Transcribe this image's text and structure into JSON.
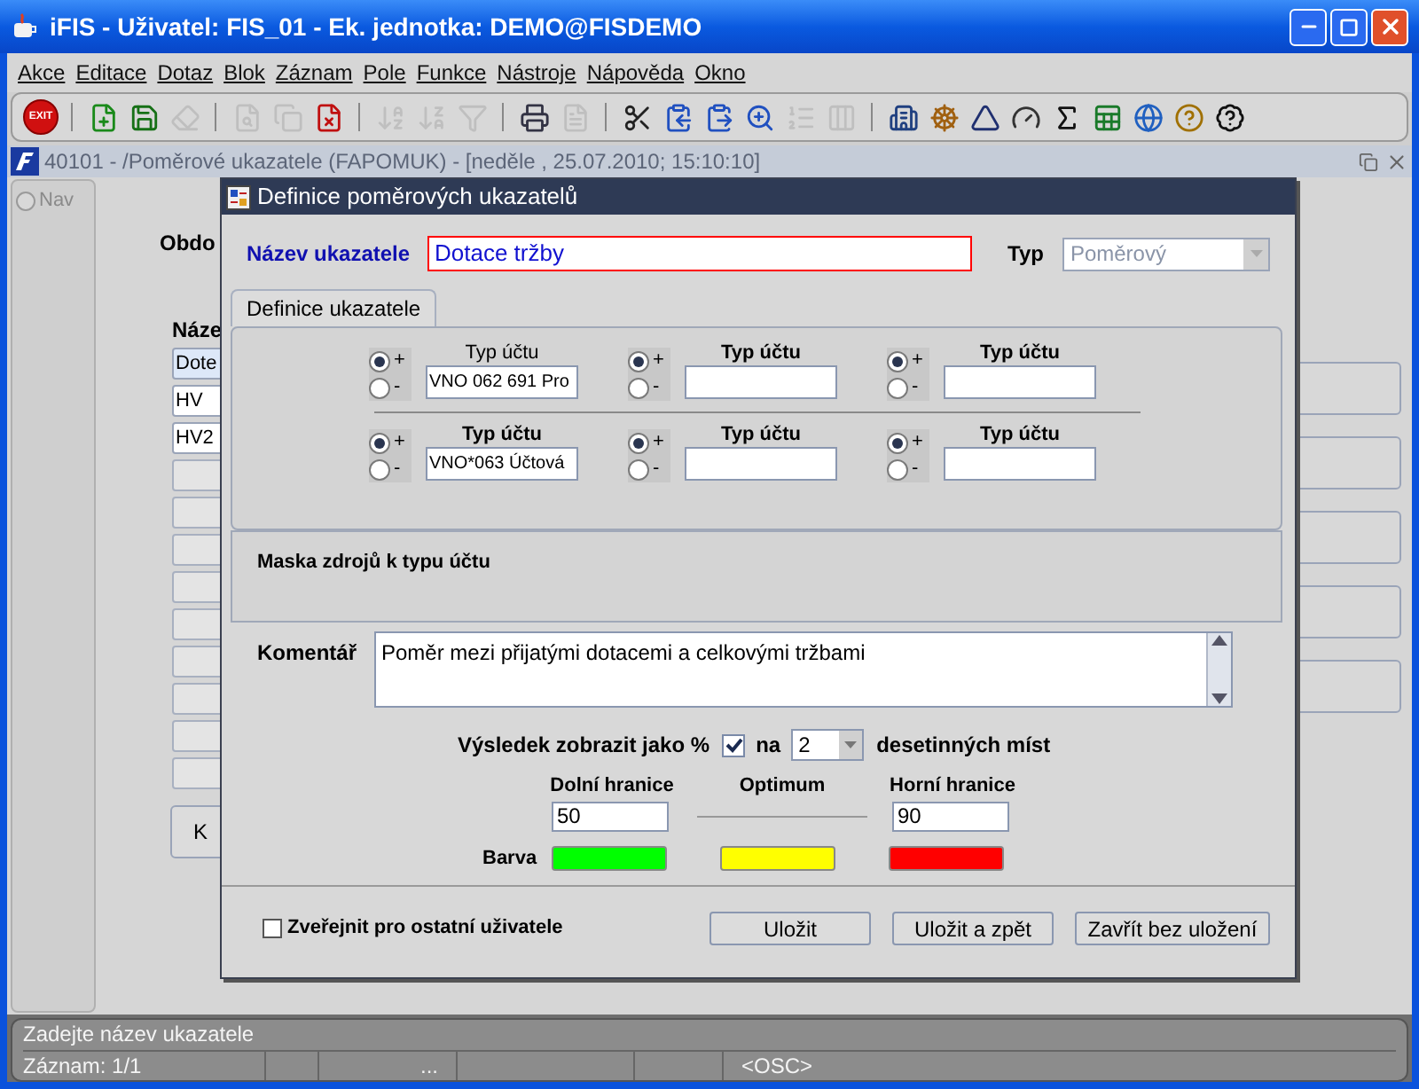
{
  "window": {
    "title": "iFIS - Uživatel: FIS_01 - Ek. jednotka: DEMO@FISDEMO"
  },
  "menu": [
    {
      "label": "Akce"
    },
    {
      "label": "Editace"
    },
    {
      "label": "Dotaz"
    },
    {
      "label": "Blok"
    },
    {
      "label": "Záznam"
    },
    {
      "label": "Pole"
    },
    {
      "label": "Funkce"
    },
    {
      "label": "Nástroje"
    },
    {
      "label": "Nápověda"
    },
    {
      "label": "Okno"
    }
  ],
  "toolbar": {
    "exit_label": "EXIT",
    "items": [
      {
        "disabled": false
      },
      {
        "disabled": false
      },
      {
        "disabled": true
      },
      {
        "disabled": true
      },
      {
        "disabled": true
      },
      {
        "disabled": false
      },
      {
        "disabled": true
      },
      {
        "disabled": true
      },
      {
        "disabled": true
      },
      {
        "disabled": false
      },
      {
        "disabled": true
      },
      {
        "disabled": false
      },
      {
        "disabled": false
      },
      {
        "disabled": false
      },
      {
        "disabled": false
      },
      {
        "disabled": true
      },
      {
        "disabled": true
      },
      {
        "disabled": false
      },
      {
        "disabled": false
      },
      {
        "disabled": false
      },
      {
        "disabled": false
      },
      {
        "disabled": false
      },
      {
        "disabled": false
      },
      {
        "disabled": false
      },
      {
        "disabled": false
      },
      {
        "disabled": false
      }
    ]
  },
  "form_window": {
    "title": "40101 - /Poměrové ukazatele (FAPOMUK) - [neděle , 25.07.2010; 15:10:10]"
  },
  "nav": {
    "label": "Nav",
    "selected": false
  },
  "background_form": {
    "period_label": "Obdo",
    "name_label": "Náze",
    "rows": [
      {
        "value": "Dote",
        "selected": true
      },
      {
        "value": "HV",
        "selected": false
      },
      {
        "value": "HV2",
        "selected": false
      }
    ],
    "button_label": "K"
  },
  "dialog": {
    "title": "Definice poměrových ukazatelů",
    "name_label": "Název ukazatele",
    "name_value": "Dotace tržby",
    "type_label": "Typ",
    "type_value": "Poměrový",
    "tabs": [
      {
        "label": "Definice ukazatele",
        "selected": true
      }
    ],
    "account_rows": [
      [
        {
          "label": "Typ účtu",
          "bold": false,
          "value": "VNO 062 691 Pro",
          "options": [
            {
              "label": "+",
              "selected": true
            },
            {
              "label": "-",
              "selected": false
            }
          ]
        },
        {
          "label": "Typ účtu",
          "bold": true,
          "options": [
            {
              "label": "+",
              "selected": true
            },
            {
              "label": "-",
              "selected": false
            }
          ]
        },
        {
          "label": "Typ účtu",
          "bold": true,
          "options": [
            {
              "label": "+",
              "selected": true
            },
            {
              "label": "-",
              "selected": false
            }
          ]
        }
      ],
      [
        {
          "label": "Typ účtu",
          "bold": true,
          "value": "VNO*063 Účtová",
          "options": [
            {
              "label": "+",
              "selected": true
            },
            {
              "label": "-",
              "selected": false
            }
          ]
        },
        {
          "label": "Typ účtu",
          "bold": true,
          "options": [
            {
              "label": "+",
              "selected": true
            },
            {
              "label": "-",
              "selected": false
            }
          ]
        },
        {
          "label": "Typ účtu",
          "bold": true,
          "options": [
            {
              "label": "+",
              "selected": true
            },
            {
              "label": "-",
              "selected": false
            }
          ]
        }
      ]
    ],
    "mask_label": "Maska zdrojů k typu účtu",
    "comment_label": "Komentář",
    "comment": "Poměr mezi přijatými dotacemi a celkovými tržbami",
    "percent_label": "Výsledek zobrazit jako %",
    "percent_checked": true,
    "decimals_prefix": "na",
    "decimals": "2",
    "decimals_suffix": "desetinných míst",
    "color_label": "Barva",
    "thresholds": [
      {
        "label": "Dolní hranice",
        "value": "50",
        "color": "#00ff00"
      },
      {
        "label": "Optimum",
        "color": "#ffff00"
      },
      {
        "label": "Horní hranice",
        "value": "90",
        "color": "#ff0000"
      }
    ],
    "publish": {
      "label": "Zveřejnit pro ostatní uživatele",
      "checked": false
    },
    "buttons": [
      {
        "label": "Uložit"
      },
      {
        "label": "Uložit a zpět"
      },
      {
        "label": "Zavřít bez uložení"
      }
    ]
  },
  "status_bar": {
    "message": "Zadejte název ukazatele",
    "record": "Záznam: 1/1",
    "cell_3": "...",
    "mode": "<OSC>"
  }
}
